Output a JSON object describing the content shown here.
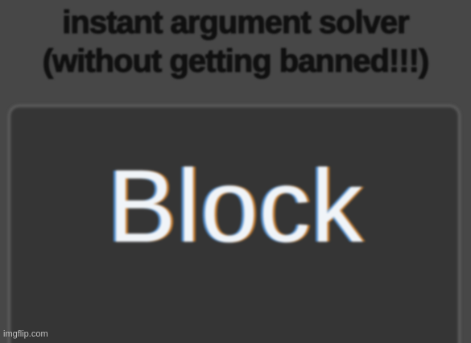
{
  "caption": {
    "line1": "instant argument solver",
    "line2": "(without getting banned!!!)"
  },
  "button": {
    "label": "Block"
  },
  "watermark": "imgflip.com",
  "colors": {
    "background": "#474747",
    "button_fill": "#353535",
    "button_border": "#606060",
    "caption_text": "#101010",
    "button_text": "#f0f4f8"
  }
}
